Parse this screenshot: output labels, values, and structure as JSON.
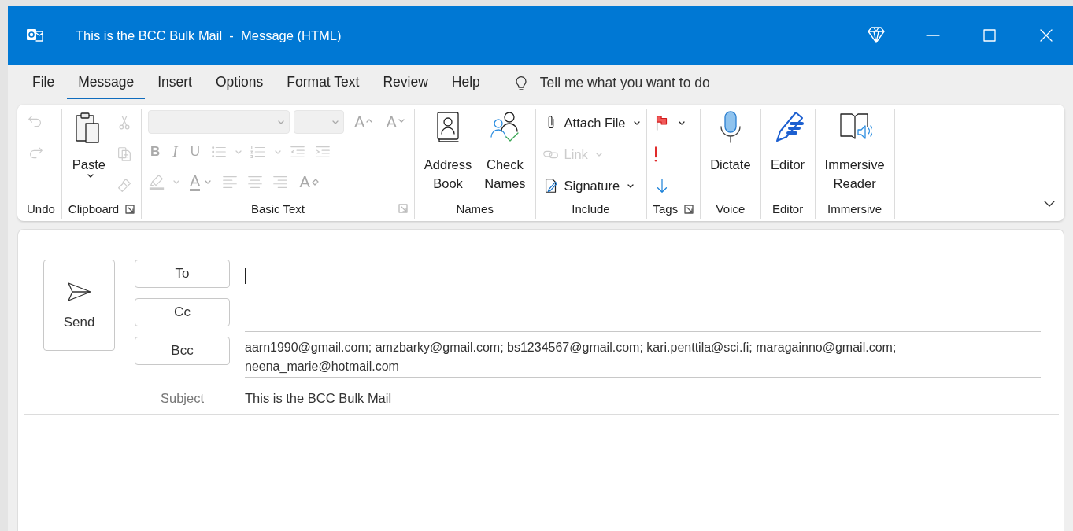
{
  "window": {
    "title": "This is the BCC Bulk Mail  -  Message (HTML)"
  },
  "menu_tabs": [
    {
      "label": "File",
      "selected": false
    },
    {
      "label": "Message",
      "selected": true
    },
    {
      "label": "Insert",
      "selected": false
    },
    {
      "label": "Options",
      "selected": false
    },
    {
      "label": "Format Text",
      "selected": false
    },
    {
      "label": "Review",
      "selected": false
    },
    {
      "label": "Help",
      "selected": false
    }
  ],
  "tell_me": {
    "placeholder": "Tell me what you want to do"
  },
  "ribbon_groups": [
    {
      "label": "Undo",
      "launcher": false,
      "items": [
        {
          "kind": "undo",
          "disabled": true,
          "dropdown": false
        },
        {
          "kind": "redo",
          "disabled": true,
          "dropdown": false
        }
      ]
    },
    {
      "label": "Clipboard",
      "launcher": true,
      "items": [
        {
          "kind": "paste",
          "label": [
            "Paste"
          ],
          "disabled": false,
          "dropdown": true
        },
        {
          "kind": "cut",
          "disabled": true,
          "dropdown": false
        },
        {
          "kind": "copy",
          "disabled": true,
          "dropdown": false
        },
        {
          "kind": "painter",
          "disabled": true,
          "dropdown": false
        }
      ]
    },
    {
      "label": "Basic Text",
      "launcher": true,
      "items": [
        {
          "kind": "font-combo",
          "disabled": true,
          "dropdown": true
        },
        {
          "kind": "size-combo",
          "disabled": true,
          "dropdown": true
        },
        {
          "kind": "grow",
          "label": "A",
          "disabled": true,
          "dropdown": false
        },
        {
          "kind": "shrink",
          "label": "A",
          "disabled": true,
          "dropdown": false
        },
        {
          "kind": "bold",
          "label": "B",
          "disabled": true,
          "dropdown": false
        },
        {
          "kind": "italic",
          "label": "I",
          "disabled": true,
          "dropdown": false
        },
        {
          "kind": "underline",
          "label": "U",
          "disabled": true,
          "dropdown": false
        },
        {
          "kind": "bullets",
          "disabled": true,
          "dropdown": true
        },
        {
          "kind": "numbering",
          "disabled": true,
          "dropdown": true
        },
        {
          "kind": "outdent",
          "disabled": true,
          "dropdown": false
        },
        {
          "kind": "indent",
          "disabled": true,
          "dropdown": false
        },
        {
          "kind": "highlight",
          "disabled": true,
          "dropdown": true
        },
        {
          "kind": "font-color",
          "label": "A",
          "disabled": true,
          "dropdown": true
        },
        {
          "kind": "align-left",
          "disabled": true,
          "dropdown": false
        },
        {
          "kind": "align-center",
          "disabled": true,
          "dropdown": false
        },
        {
          "kind": "align-right",
          "disabled": true,
          "dropdown": false
        },
        {
          "kind": "clear-format",
          "label": "A",
          "disabled": true,
          "dropdown": false
        }
      ]
    },
    {
      "label": "Names",
      "launcher": false,
      "items": [
        {
          "kind": "address-book",
          "label": [
            "Address",
            "Book"
          ],
          "disabled": false,
          "dropdown": false
        },
        {
          "kind": "check-names",
          "label": [
            "Check",
            "Names"
          ],
          "disabled": false,
          "dropdown": false
        }
      ]
    },
    {
      "label": "Include",
      "launcher": false,
      "items": [
        {
          "kind": "attach",
          "label": "Attach File",
          "disabled": false,
          "dropdown": true
        },
        {
          "kind": "link",
          "label": "Link",
          "disabled": true,
          "dropdown": true
        },
        {
          "kind": "signature",
          "label": "Signature",
          "disabled": false,
          "dropdown": true
        }
      ]
    },
    {
      "label": "Tags",
      "launcher": true,
      "items": [
        {
          "kind": "flag",
          "disabled": false,
          "dropdown": true
        },
        {
          "kind": "high-importance",
          "disabled": false,
          "dropdown": false
        },
        {
          "kind": "low-importance",
          "disabled": false,
          "dropdown": false
        }
      ]
    },
    {
      "label": "Voice",
      "launcher": false,
      "items": [
        {
          "kind": "microphone",
          "label": [
            "Dictate"
          ],
          "disabled": false,
          "dropdown": false
        }
      ]
    },
    {
      "label": "Editor",
      "launcher": false,
      "items": [
        {
          "kind": "editor",
          "label": [
            "Editor"
          ],
          "disabled": false,
          "dropdown": false
        }
      ]
    },
    {
      "label": "Immersive",
      "launcher": false,
      "items": [
        {
          "kind": "reader",
          "label": [
            "Immersive",
            "Reader"
          ],
          "disabled": false,
          "dropdown": false
        }
      ]
    }
  ],
  "compose": {
    "send": {
      "label": "Send"
    },
    "recipients": [
      {
        "label": "To",
        "focused": true
      },
      {
        "label": "Cc",
        "focused": false
      },
      {
        "label": "Bcc",
        "focused": false,
        "value": "aarn1990@gmail.com; amzbarky@gmail.com; bs1234567@gmail.com; kari.penttila@sci.fi; maragainno@gmail.com; neena_marie@hotmail.com"
      }
    ],
    "subject": {
      "label": "Subject",
      "value": "This is the BCC Bulk Mail"
    }
  }
}
